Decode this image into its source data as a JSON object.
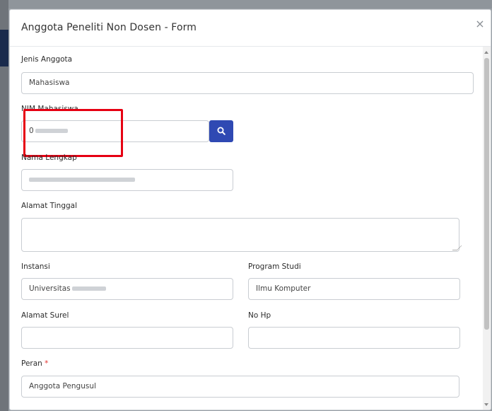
{
  "modal": {
    "title": "Anggota Peneliti Non Dosen - Form",
    "close_glyph": "×"
  },
  "form": {
    "jenis_anggota": {
      "label": "Jenis Anggota",
      "value": "Mahasiswa"
    },
    "nim": {
      "label": "NIM Mahasiswa",
      "value_prefix": "0"
    },
    "nama_lengkap": {
      "label": "Nama Lengkap",
      "value": ""
    },
    "alamat_tinggal": {
      "label": "Alamat Tinggal",
      "value": ""
    },
    "instansi": {
      "label": "Instansi",
      "value_prefix": "Universitas"
    },
    "program_studi": {
      "label": "Program Studi",
      "value": "Ilmu Komputer"
    },
    "alamat_surel": {
      "label": "Alamat Surel",
      "value": ""
    },
    "no_hp": {
      "label": "No Hp",
      "value": ""
    },
    "peran": {
      "label": "Peran",
      "required_marker": "*",
      "value": "Anggota Pengusul"
    }
  },
  "icons": {
    "search": "search-icon",
    "close": "close-icon"
  },
  "colors": {
    "primary_button": "#2f49b3",
    "highlight_border": "#e60012",
    "required": "#e3342f"
  }
}
